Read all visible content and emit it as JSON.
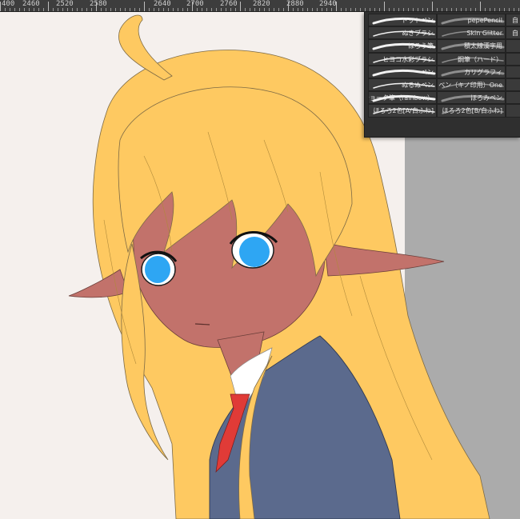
{
  "ruler": {
    "labels": [
      "400",
      "2460",
      "2520",
      "2580",
      "2640",
      "2700",
      "2760",
      "2820",
      "2880",
      "2940"
    ]
  },
  "colors": {
    "paper": "#f5f0ed",
    "panel_gray": "#ababab",
    "hair": "#fec961",
    "skin": "#c2726b",
    "eye": "#2ea6f3",
    "blazer": "#5b6a8d",
    "shirt": "#ffffff",
    "tie": "#e03b37"
  },
  "brush_panel": {
    "rows": [
      [
        "ドットペン",
        "pepePencil",
        "自"
      ],
      [
        "ぬきブラシ",
        "Skin Glitter",
        "自"
      ],
      [
        "ほろう筆",
        "積太線漢字用",
        ""
      ],
      [
        "ヒヨコ水彩ブラシ",
        "鋼筆（ハード）",
        ""
      ],
      [
        "ペン",
        "カリグラフィ",
        ""
      ],
      [
        "ぬるぬペン",
        "ペン（キノ印用）One",
        ""
      ],
      [
        "チョーク筆（rainbow）",
        "ほろみペン",
        ""
      ],
      [
        "ほろろ2色[A/白ふわ]",
        "ほろろ2色[B/白ふわ]",
        ""
      ]
    ]
  }
}
